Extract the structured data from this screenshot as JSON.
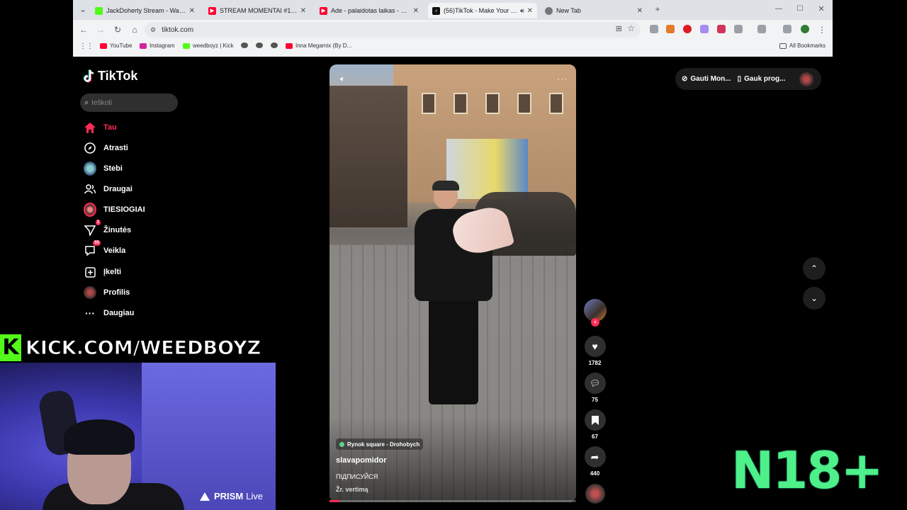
{
  "browser": {
    "tabs": [
      {
        "title": "JackDoherty Stream - Watch Li",
        "favicon_color": "#53fc18",
        "active": false
      },
      {
        "title": "STREAM MOMENTAI #12 | VAS",
        "favicon_color": "#ff0033",
        "active": false
      },
      {
        "title": "Ade - palaidotas laikas - YouTu",
        "favicon_color": "#ff0033",
        "active": false
      },
      {
        "title": "(56)TikTok - Make Your Day",
        "favicon_color": "#111111",
        "active": true
      },
      {
        "title": "New Tab",
        "favicon_color": "#777777",
        "active": false
      }
    ],
    "url": "tiktok.com",
    "bookmarks": [
      "YouTube",
      "Instagram",
      "weedboyz | Kick",
      "Inna Megamix (By D...",
      "All Bookmarks"
    ]
  },
  "sidebar": {
    "logo_text": "TikTok",
    "search_placeholder": "Ieškoti",
    "items": [
      {
        "label": "Tau",
        "icon": "home-icon",
        "active": true
      },
      {
        "label": "Atrasti",
        "icon": "compass-icon"
      },
      {
        "label": "Stebi",
        "icon": "following-avatar-icon"
      },
      {
        "label": "Draugai",
        "icon": "friends-icon"
      },
      {
        "label": "TIESIOGIAI",
        "icon": "live-avatar-icon"
      },
      {
        "label": "Žinutės",
        "icon": "messages-icon",
        "badge": "1"
      },
      {
        "label": "Veikla",
        "icon": "activity-icon",
        "badge": "55"
      },
      {
        "label": "Įkelti",
        "icon": "upload-icon"
      },
      {
        "label": "Profilis",
        "icon": "profile-avatar-icon"
      },
      {
        "label": "Daugiau",
        "icon": "more-icon"
      }
    ]
  },
  "video": {
    "location": "Rynok square - Drohobych",
    "author": "slavapomidor",
    "caption": "ПІДПИСУЙСЯ",
    "translate": "Žr. vertimą",
    "progress": 0.04
  },
  "actions": {
    "likes": "1782",
    "comments": "75",
    "saves": "67",
    "shares": "440"
  },
  "topright": {
    "coins": "Gauti Mon...",
    "app": "Gauk prog..."
  },
  "overlay": {
    "kick_text": "KICK.COM/WEEDBOYZ",
    "kick_logo": "K",
    "prism_brand": "PRISM",
    "prism_suffix": "Live",
    "rating": "N18+"
  },
  "colors": {
    "accent": "#fe2c55",
    "kick_green": "#53fc18",
    "rating_green": "#4ef08a"
  }
}
